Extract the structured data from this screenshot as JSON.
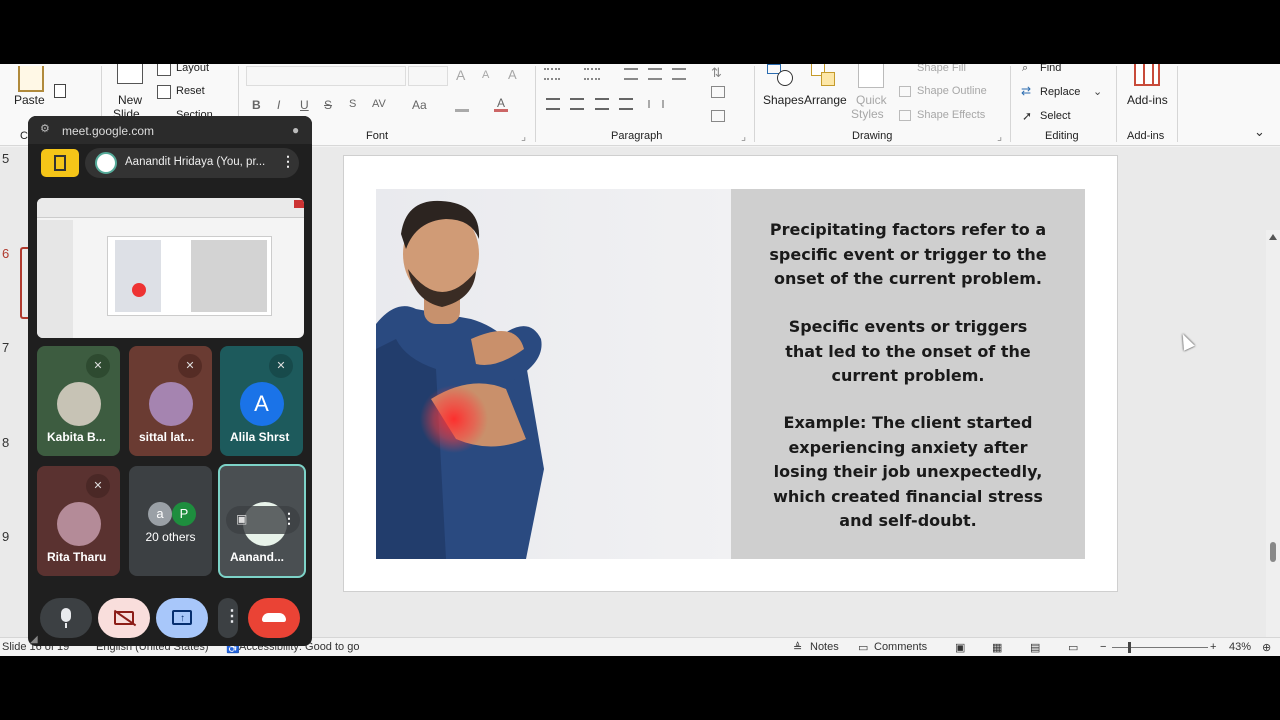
{
  "ribbon": {
    "clipboard": {
      "paste": "Paste",
      "group": "Cli"
    },
    "slides": {
      "new_slide": "New",
      "new_slide2": "Slide",
      "layout": "Layout",
      "reset": "Reset",
      "section": "Section"
    },
    "font": {
      "group": "Font",
      "bold": "B",
      "italic": "I",
      "underline": "U",
      "strike": "S",
      "spacing": "AV",
      "case": "Aa",
      "grow": "A",
      "shrink": "A"
    },
    "paragraph": {
      "group": "Paragraph"
    },
    "drawing": {
      "group": "Drawing",
      "shapes": "Shapes",
      "arrange": "Arrange",
      "quick_styles": "Quick",
      "quick_styles2": "Styles",
      "shape_fill": "Shape Fill",
      "shape_outline": "Shape Outline",
      "shape_effects": "Shape Effects"
    },
    "editing": {
      "group": "Editing",
      "find": "Find",
      "replace": "Replace",
      "select": "Select"
    },
    "addins": {
      "group": "Add-ins",
      "label": "Add-ins"
    }
  },
  "thumb_numbers": [
    "5",
    "6",
    "7",
    "8",
    "9"
  ],
  "slide": {
    "para1": [
      "Precipitating factors refer to a",
      "specific event or trigger to the",
      "onset of the current problem."
    ],
    "para2": [
      "Specific events or triggers",
      "that led to the onset of the",
      "current problem."
    ],
    "para3": [
      "Example: The client started",
      "experiencing anxiety after",
      "losing their job unexpectedly,",
      "which created financial stress",
      "and self-doubt."
    ]
  },
  "statusbar": {
    "slide": "Slide 16 of 19",
    "language": "English (United States)",
    "accessibility": "Accessibility: Good to go",
    "notes": "Notes",
    "comments": "Comments",
    "zoom": "43%"
  },
  "meet": {
    "url": "meet.google.com",
    "presenter": "Aanandit Hridaya (You, pr...",
    "participants": [
      {
        "name": "Kabita B...",
        "muted": true
      },
      {
        "name": "sittal lat...",
        "muted": true
      },
      {
        "name": "Alila Shrst",
        "muted": true,
        "initial": "A"
      },
      {
        "name": "Rita Tharu",
        "muted": true
      },
      {
        "name": "20 others",
        "initials": [
          "a",
          "P"
        ]
      },
      {
        "name": "Aanand...",
        "muted": false
      }
    ]
  },
  "colors": {
    "accent_red": "#ea4335",
    "meet_bg": "#1f1f1f",
    "active_tile": "#7dd3c8",
    "present_btn": "#a8c7fa",
    "cam_off_btn": "#f9dedc",
    "avatar_blue": "#1a73e8"
  }
}
